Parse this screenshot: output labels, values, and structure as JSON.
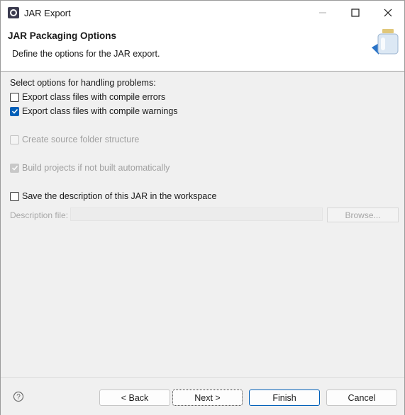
{
  "window": {
    "title": "JAR Export"
  },
  "banner": {
    "title": "JAR Packaging Options",
    "description": "Define the options for the JAR export."
  },
  "problems": {
    "label": "Select options for handling problems:",
    "options": [
      {
        "label": "Export class files with compile errors",
        "checked": false,
        "enabled": true
      },
      {
        "label": "Export class files with compile warnings",
        "checked": true,
        "enabled": true
      }
    ]
  },
  "structure": {
    "label": "Create source folder structure",
    "checked": false,
    "enabled": false
  },
  "build": {
    "label": "Build projects if not built automatically",
    "checked": true,
    "enabled": false
  },
  "save_description": {
    "label": "Save the description of this JAR in the workspace",
    "checked": false,
    "enabled": true
  },
  "description_file": {
    "label": "Description file:",
    "value": "",
    "browse_label": "Browse..."
  },
  "footer": {
    "back_label": "< Back",
    "next_label": "Next >",
    "finish_label": "Finish",
    "cancel_label": "Cancel"
  },
  "colors": {
    "accent": "#005fb8"
  }
}
